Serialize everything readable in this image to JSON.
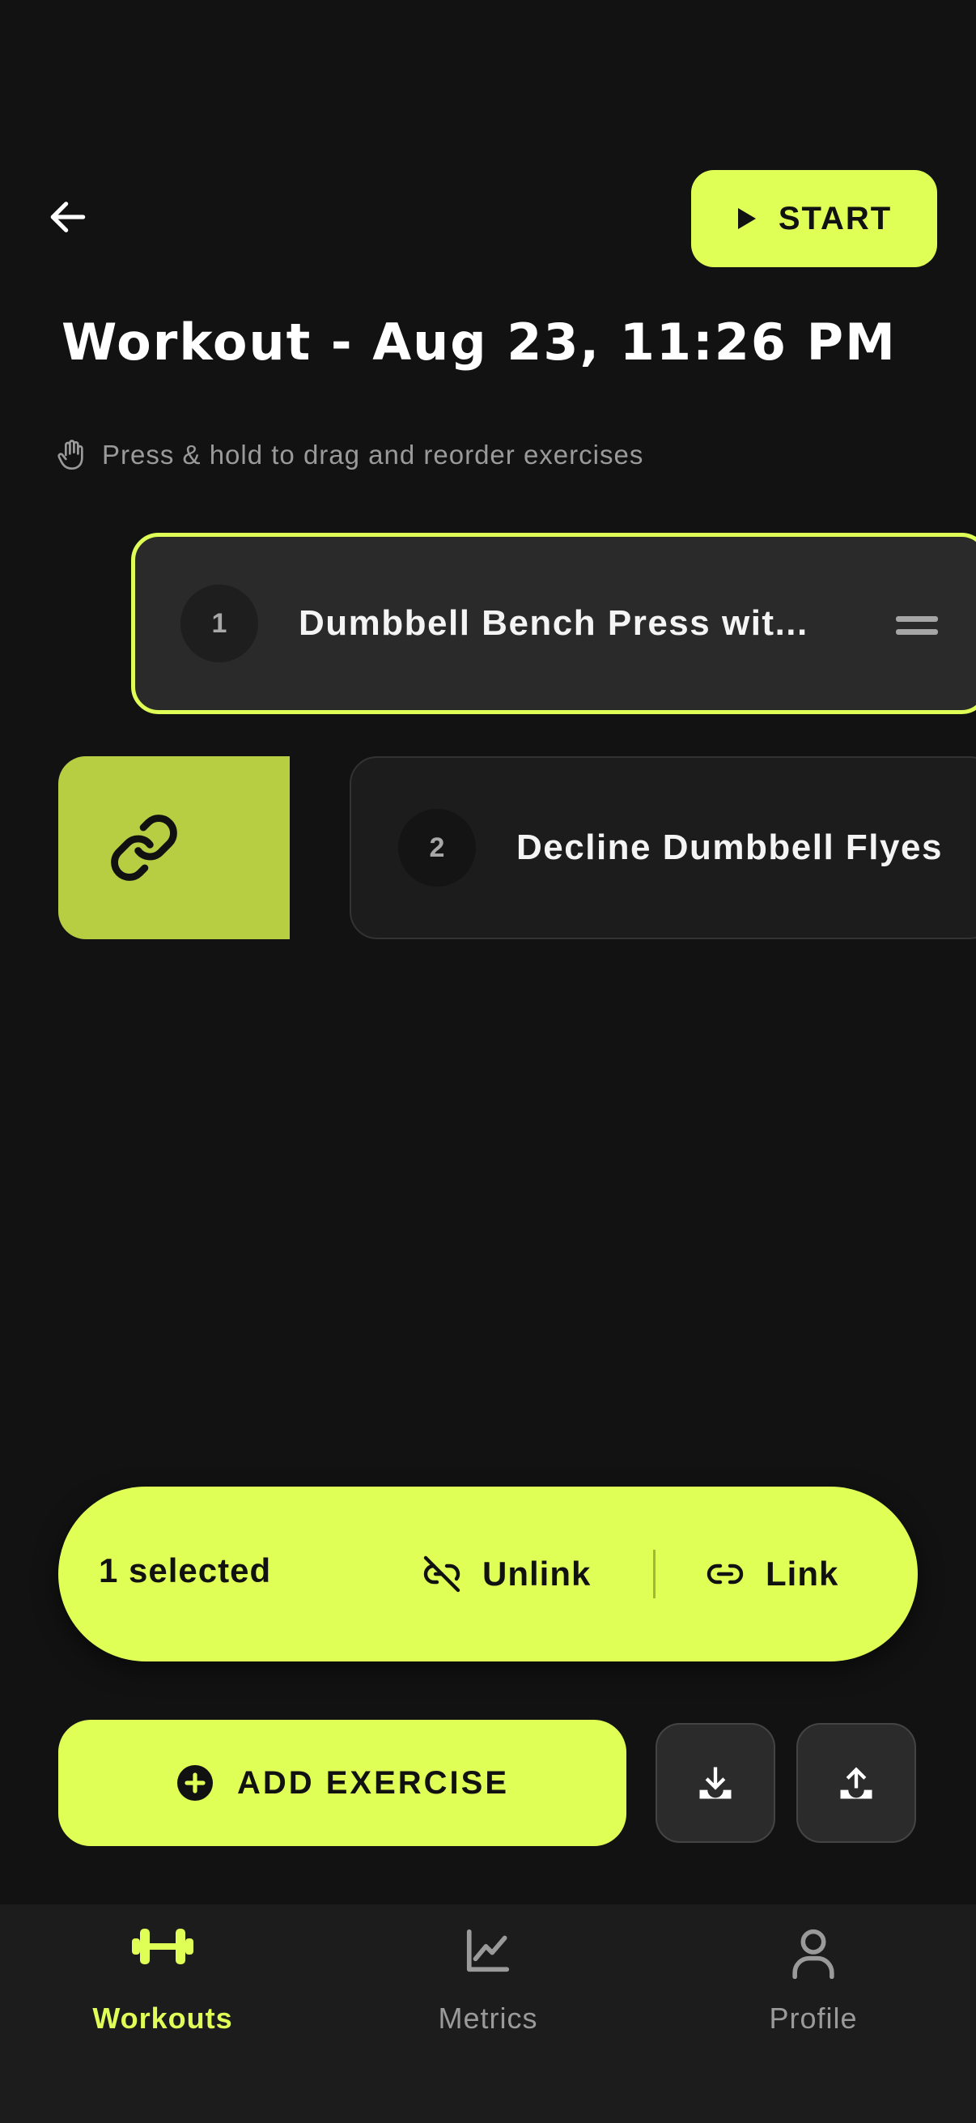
{
  "header": {
    "start_label": "START",
    "title": "Workout - Aug 23, 11:26 PM",
    "hint": "Press & hold to drag and reorder exercises"
  },
  "exercises": [
    {
      "number": "1",
      "name": "Dumbbell Bench Press wit...",
      "selected": true
    },
    {
      "number": "2",
      "name": "Decline Dumbbell Flyes",
      "selected": false
    }
  ],
  "selection_bar": {
    "count_label": "1 selected",
    "unlink_label": "Unlink",
    "link_label": "Link"
  },
  "actions": {
    "add_exercise_label": "ADD EXERCISE",
    "download_icon": "download-icon",
    "upload_icon": "upload-icon"
  },
  "tabs": [
    {
      "label": "Workouts",
      "icon": "dumbbell-icon",
      "active": true
    },
    {
      "label": "Metrics",
      "icon": "chart-icon",
      "active": false
    },
    {
      "label": "Profile",
      "icon": "person-icon",
      "active": false
    }
  ],
  "colors": {
    "background": "#121212",
    "accent": "#DFFF57",
    "link_action": "#B7CE43",
    "card": "#2A2A2A",
    "muted_text": "#9A9A9A"
  }
}
